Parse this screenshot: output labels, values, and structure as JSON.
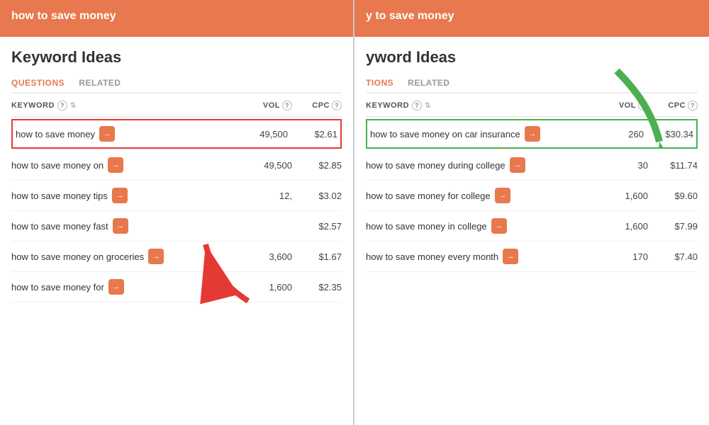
{
  "left_panel": {
    "search_bar": "how to save money",
    "section_title": "Keyword Ideas",
    "tabs": [
      {
        "label": "QUESTIONS",
        "active": true
      },
      {
        "label": "RELATED",
        "active": false
      }
    ],
    "columns": [
      {
        "label": "KEYWORD",
        "has_sort": true,
        "has_help": true
      },
      {
        "label": "VOL",
        "has_sort": false,
        "has_help": true
      },
      {
        "label": "CPC",
        "has_sort": false,
        "has_help": true
      }
    ],
    "rows": [
      {
        "keyword": "how to save money",
        "vol": "49,500",
        "cpc": "$2.61",
        "highlighted": "red"
      },
      {
        "keyword": "how to save money on",
        "vol": "49,500",
        "cpc": "$2.85",
        "highlighted": "none"
      },
      {
        "keyword": "how to save money tips",
        "vol": "12,",
        "cpc": "$3.02",
        "highlighted": "none"
      },
      {
        "keyword": "how to save money fast",
        "vol": "",
        "cpc": "$2.57",
        "highlighted": "none"
      },
      {
        "keyword": "how to save money on groceries",
        "vol": "3,600",
        "cpc": "$1.67",
        "highlighted": "none"
      },
      {
        "keyword": "how to save money for",
        "vol": "1,600",
        "cpc": "$2.35",
        "highlighted": "none"
      }
    ]
  },
  "right_panel": {
    "search_bar": "y to save money",
    "section_title": "yword Ideas",
    "tabs": [
      {
        "label": "TIONS",
        "active": true
      },
      {
        "label": "RELATED",
        "active": false
      }
    ],
    "columns": [
      {
        "label": "KEYWORD",
        "has_sort": true,
        "has_help": true
      },
      {
        "label": "VOL",
        "has_sort": false,
        "has_help": true
      },
      {
        "label": "CPC",
        "has_sort": false,
        "has_help": true
      }
    ],
    "rows": [
      {
        "keyword": "how to save money on car insurance",
        "vol": "260",
        "cpc": "$30.34",
        "highlighted": "green"
      },
      {
        "keyword": "how to save money during college",
        "vol": "30",
        "cpc": "$11.74",
        "highlighted": "none"
      },
      {
        "keyword": "how to save money for college",
        "vol": "1,600",
        "cpc": "$9.60",
        "highlighted": "none"
      },
      {
        "keyword": "how to save money in college",
        "vol": "1,600",
        "cpc": "$7.99",
        "highlighted": "none"
      },
      {
        "keyword": "how to save money every month",
        "vol": "170",
        "cpc": "$7.40",
        "highlighted": "none"
      }
    ]
  },
  "icons": {
    "arrow_right": "→",
    "sort": "⇅",
    "help": "?",
    "red_arrow": "red arrow pointing up-left",
    "green_arrow": "green arrow pointing down-right"
  }
}
